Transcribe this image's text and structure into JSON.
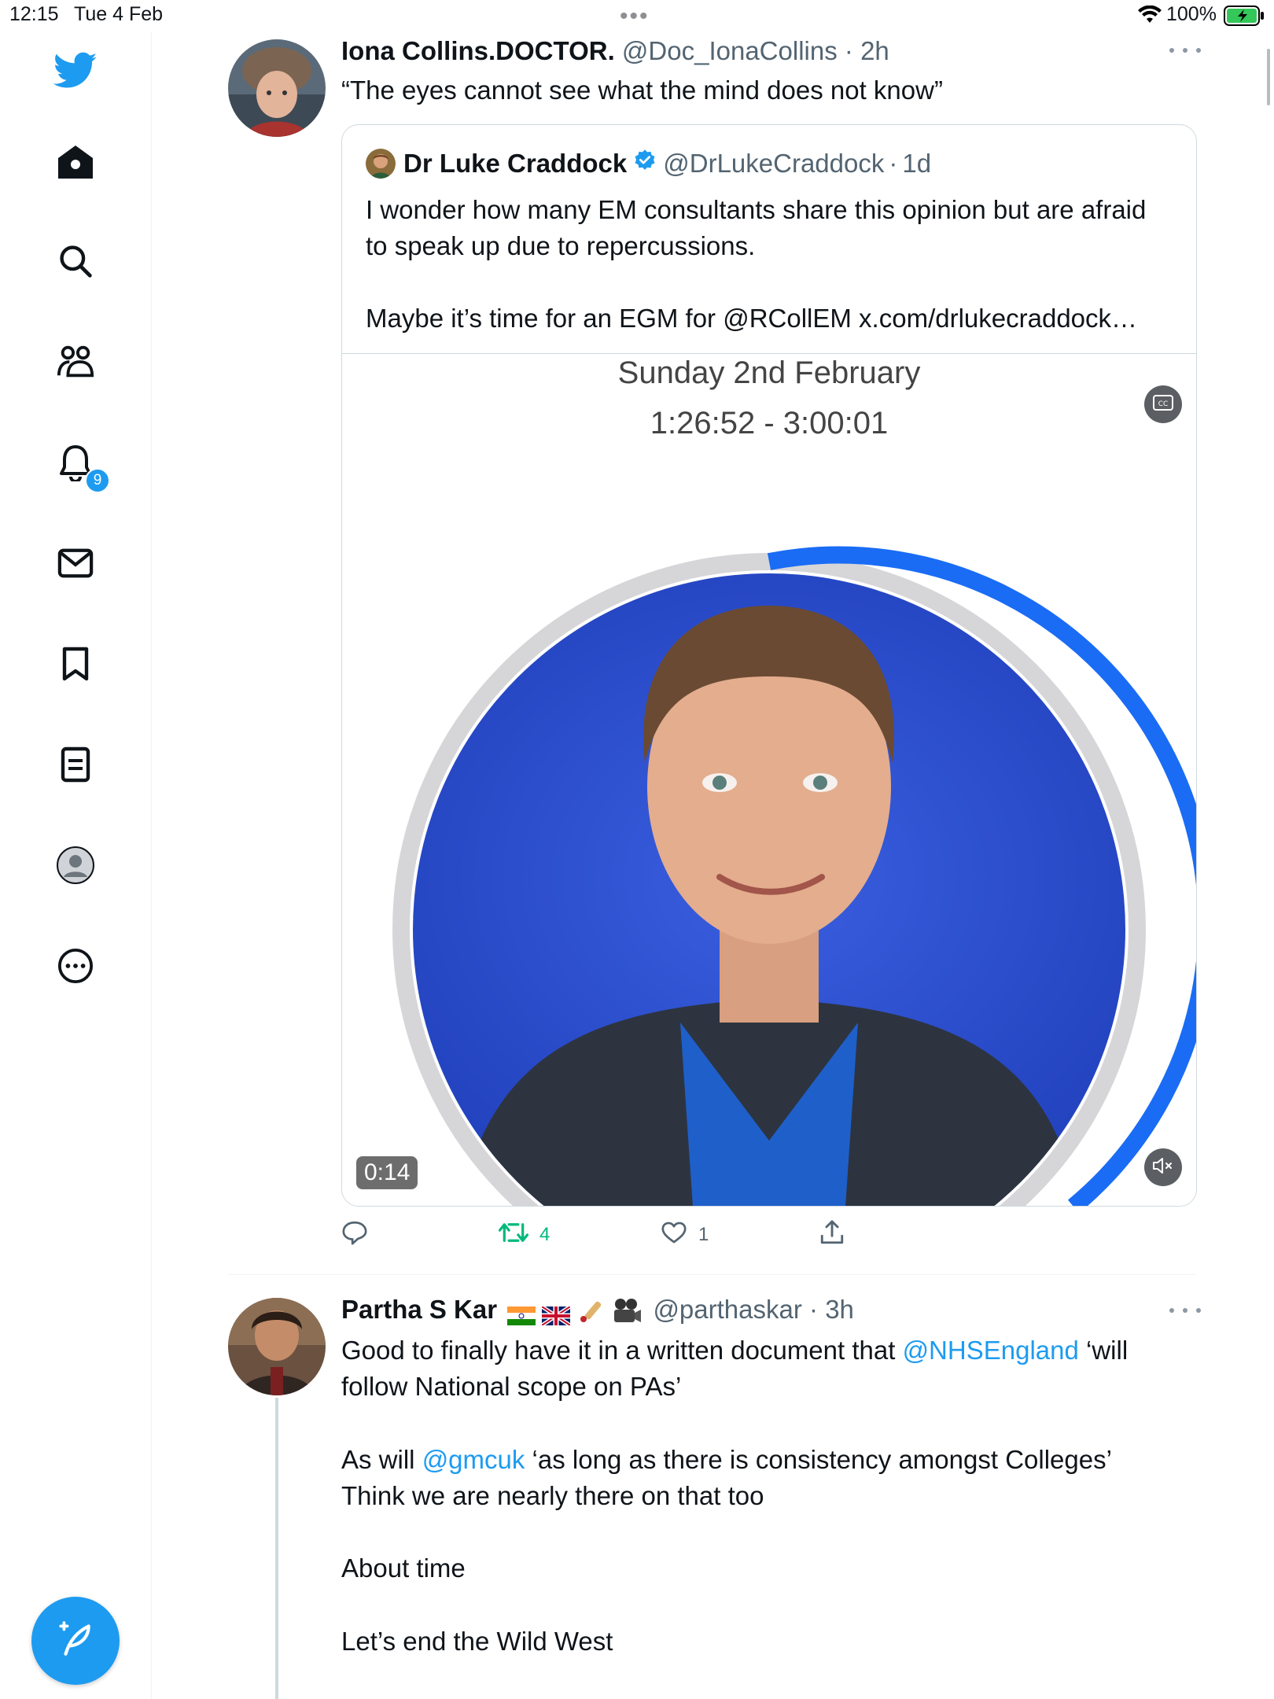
{
  "status_bar": {
    "time": "12:15",
    "date": "Tue 4 Feb",
    "battery_pct": "100%"
  },
  "sidebar": {
    "items": [
      {
        "name": "twitter-logo-icon"
      },
      {
        "name": "home-icon"
      },
      {
        "name": "search-icon"
      },
      {
        "name": "communities-icon"
      },
      {
        "name": "notifications-icon"
      },
      {
        "name": "messages-icon"
      },
      {
        "name": "bookmarks-icon"
      },
      {
        "name": "lists-icon"
      },
      {
        "name": "profile-icon"
      },
      {
        "name": "more-options-icon"
      }
    ],
    "notifications_badge": "9",
    "compose": {
      "name": "compose-tweet-icon"
    }
  },
  "tweets": [
    {
      "name": "Iona Collins.DOCTOR.",
      "handle": "@Doc_IonaCollins",
      "dot": "·",
      "time": "2h",
      "text": "“The eyes cannot see what the mind does not know”",
      "quote": {
        "name": "Dr Luke Craddock",
        "verified": true,
        "handle": "@DrLukeCraddock",
        "dot": "·",
        "time": "1d",
        "text_line1": "I wonder how many EM consultants share this opinion but are afraid to speak up due to repercussions.",
        "text_prefix": "Maybe it’s time for an EGM for ",
        "text_mention": "@RCollEM",
        "text_link": " x.com/drlukecraddock…",
        "media": {
          "title_line1": "Sunday 2nd February",
          "title_line2": "1:26:52 - 3:00:01",
          "duration": "0:14"
        }
      },
      "actions": {
        "reply_count": "",
        "retweet_count": "4",
        "like_count": "1"
      }
    },
    {
      "name": "Partha S Kar",
      "handle": "@parthaskar",
      "dot": "·",
      "time": "3h",
      "text_a": "Good to finally have it in a written document that ",
      "mention_a": "@NHSEngland",
      "text_b": " ‘will follow National scope on PAs’",
      "text_c": "As will ",
      "mention_b": "@gmcuk",
      "text_d": " ‘as long as there is consistency amongst Colleges’\nThink we are nearly there on that too",
      "text_e": "About time",
      "text_f": "Let’s end the Wild West"
    }
  ],
  "colors": {
    "accent": "#1d9bf0",
    "retweet_green": "#00ba7c",
    "text_secondary": "#536471",
    "media_blue": "#2a4bd6"
  }
}
